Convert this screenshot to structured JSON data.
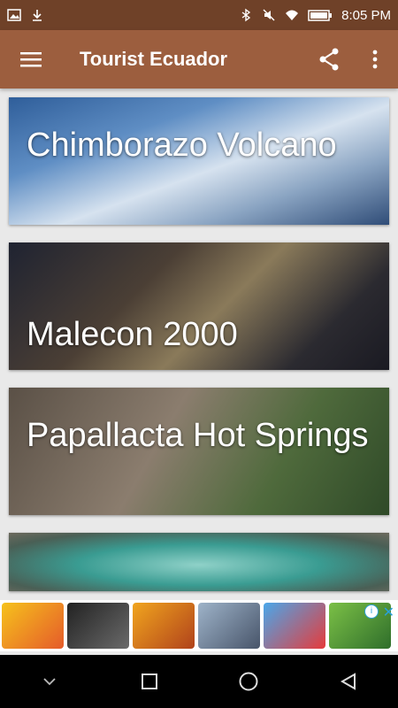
{
  "status_bar": {
    "time": "8:05 PM",
    "icons": [
      "image-icon",
      "download-icon",
      "bluetooth-icon",
      "mute-icon",
      "wifi-icon",
      "battery-icon"
    ]
  },
  "app_bar": {
    "title": "Tourist Ecuador",
    "menu_icon": "menu-icon",
    "share_icon": "share-icon",
    "overflow_icon": "more-vertical-icon",
    "background": "#9c5e3e"
  },
  "places": [
    {
      "name": "Chimborazo Volcano"
    },
    {
      "name": "Malecon 2000"
    },
    {
      "name": "Papallacta Hot Springs"
    },
    {
      "name": ""
    }
  ],
  "ad": {
    "info_label": "i",
    "close_label": "✕"
  },
  "nav_bar": {
    "buttons": [
      "chevron-down-icon",
      "recents-icon",
      "home-icon",
      "back-icon"
    ]
  }
}
